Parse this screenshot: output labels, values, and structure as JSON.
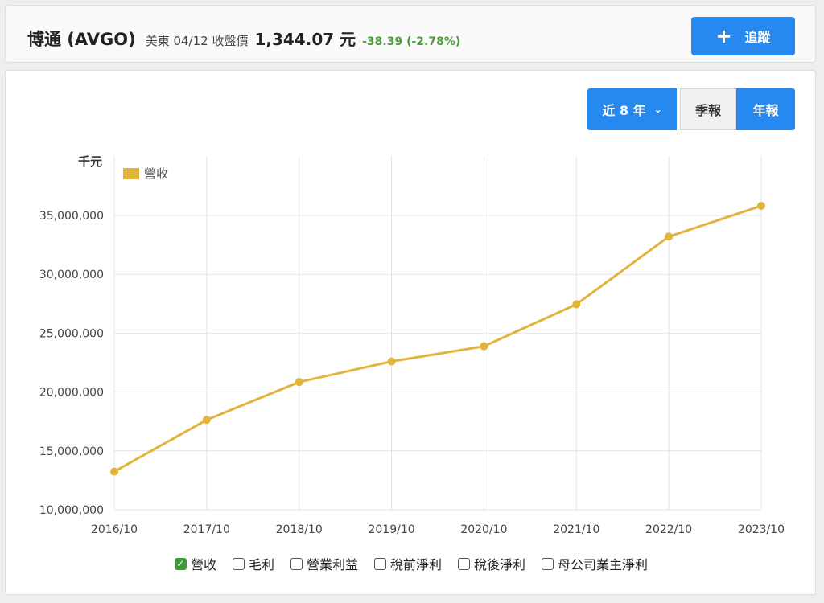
{
  "header": {
    "stock_name": "博通 (AVGO)",
    "market_date": "美東 04/12 收盤價",
    "close_price": "1,344.07 元",
    "change": "-38.39 (-2.78%)",
    "follow_plus": "+",
    "follow_label": "追蹤"
  },
  "controls": {
    "range_label": "近 8 年",
    "range_chevron": "⌄",
    "quarter_label": "季報",
    "annual_label": "年報"
  },
  "chart_data": {
    "type": "line",
    "unit_label": "千元",
    "x": [
      "2016/10",
      "2017/10",
      "2018/10",
      "2019/10",
      "2020/10",
      "2021/10",
      "2022/10",
      "2023/10"
    ],
    "series": [
      {
        "name": "營收",
        "color": "#e2b43c",
        "values": [
          13240000,
          17636000,
          20848000,
          22597000,
          23888000,
          27450000,
          33203000,
          35819000
        ]
      }
    ],
    "ylim": [
      10000000,
      35000000
    ],
    "yticks": [
      10000000,
      15000000,
      20000000,
      25000000,
      30000000,
      35000000
    ],
    "ytick_labels": [
      "10,000,000",
      "15,000,000",
      "20,000,000",
      "25,000,000",
      "30,000,000",
      "35,000,000"
    ],
    "grid": true,
    "legend_position": "top-left"
  },
  "toggles": [
    {
      "label": "營收",
      "checked": true
    },
    {
      "label": "毛利",
      "checked": false
    },
    {
      "label": "營業利益",
      "checked": false
    },
    {
      "label": "稅前淨利",
      "checked": false
    },
    {
      "label": "稅後淨利",
      "checked": false
    },
    {
      "label": "母公司業主淨利",
      "checked": false
    }
  ],
  "colors": {
    "accent": "#2589f0",
    "series": "#e2b43c",
    "change_negative": "#4d9b3c"
  }
}
